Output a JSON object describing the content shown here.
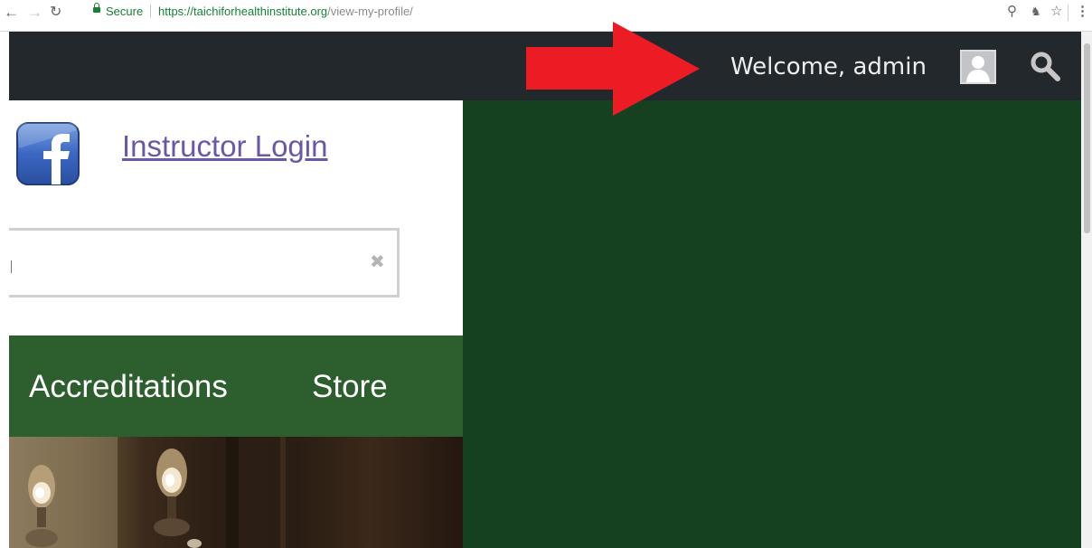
{
  "browser": {
    "secure_label": "Secure",
    "url_host": "https://taichiforhealthinstitute.org",
    "url_path": "/view-my-profile/",
    "icons": [
      "back-icon",
      "forward-icon",
      "reload-icon",
      "lock-icon",
      "zoom-icon",
      "extension-icon",
      "bookmark-star-icon",
      "menu-icon"
    ]
  },
  "header": {
    "welcome_text": "Welcome, admin",
    "background": "#23282d"
  },
  "content": {
    "instructor_login": "Instructor Login",
    "search": {
      "value": "",
      "placeholder": ""
    }
  },
  "nav": {
    "items": [
      {
        "label": "Accreditations"
      },
      {
        "label": "Store"
      }
    ],
    "background": "#2c5e2e"
  },
  "colors": {
    "green_panel": "#154120",
    "arrow": "#ec1c24",
    "link": "#6b57a8"
  }
}
